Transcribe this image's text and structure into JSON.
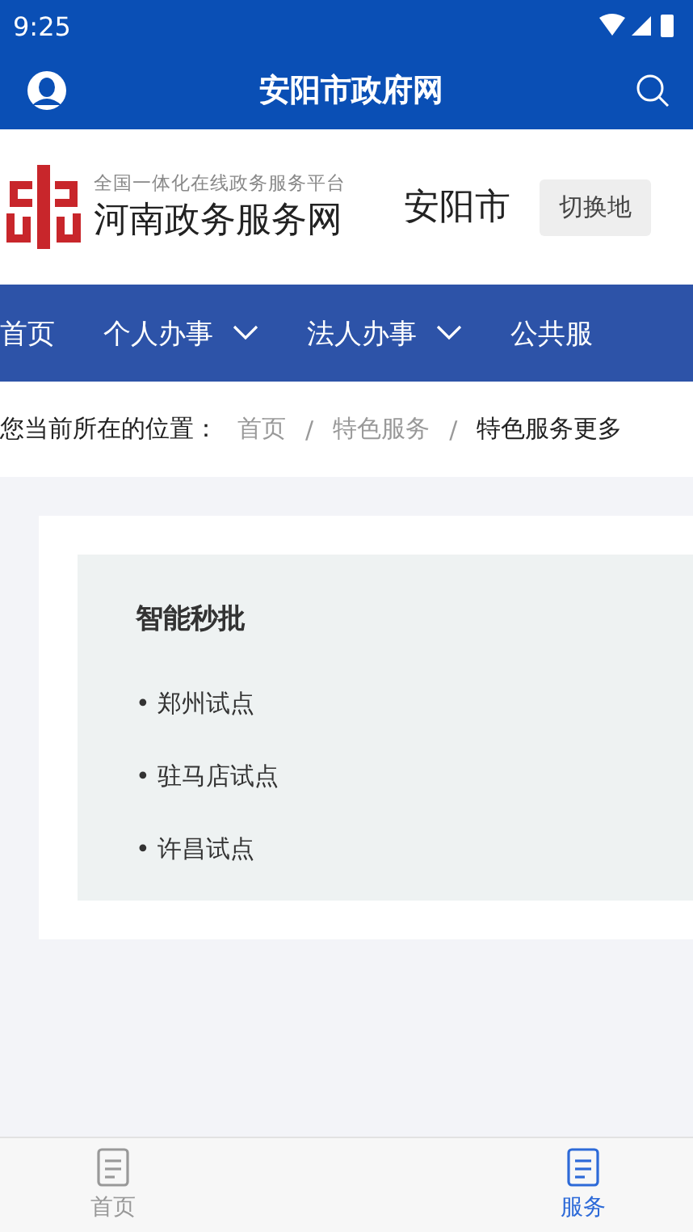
{
  "status_bar": {
    "time": "9:25"
  },
  "app_bar": {
    "title": "安阳市政府网"
  },
  "header": {
    "tagline": "全国一体化在线政务服务平台",
    "site_name": "河南政务服务网",
    "city": "安阳市",
    "switch_button": "切换地"
  },
  "nav": [
    {
      "label": "首页",
      "dropdown": false
    },
    {
      "label": "个人办事",
      "dropdown": true
    },
    {
      "label": "法人办事",
      "dropdown": true
    },
    {
      "label": "公共服",
      "dropdown": false
    }
  ],
  "breadcrumb": {
    "prefix": "您当前所在的位置：",
    "separators": [
      "/",
      "/"
    ],
    "items": [
      {
        "label": "首页",
        "current": false
      },
      {
        "label": "特色服务",
        "current": false
      },
      {
        "label": "特色服务更多",
        "current": true
      }
    ]
  },
  "panel": {
    "title": "智能秒批",
    "links": [
      "• 郑州试点",
      "• 驻马店试点",
      "• 许昌试点"
    ]
  },
  "tab_bar": [
    {
      "label": "首页",
      "selected": false
    },
    {
      "label": "服务",
      "selected": true
    }
  ]
}
